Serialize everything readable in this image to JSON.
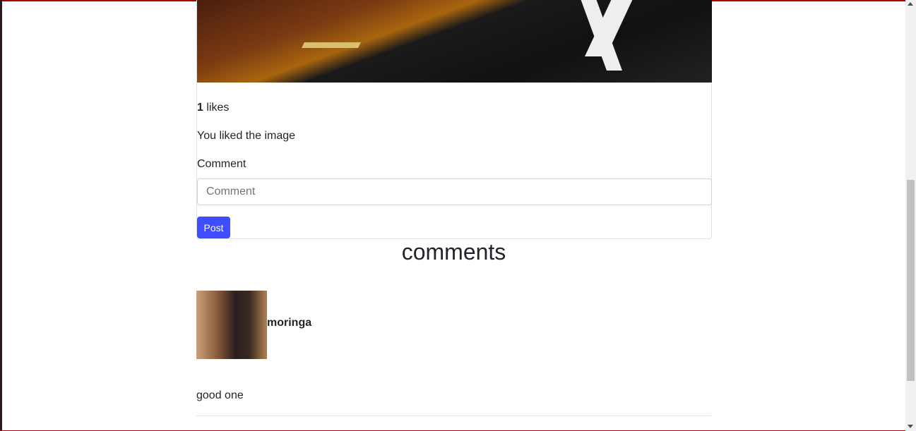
{
  "post": {
    "likes_count": "1",
    "likes_suffix": " likes",
    "liked_status": "You liked the image",
    "comment_label": "Comment",
    "comment_placeholder": "Comment",
    "post_button": "Post"
  },
  "comments": {
    "heading": "comments",
    "items": [
      {
        "username": "moringa",
        "text": "good one"
      }
    ]
  },
  "colors": {
    "primary": "#3f4cff"
  }
}
